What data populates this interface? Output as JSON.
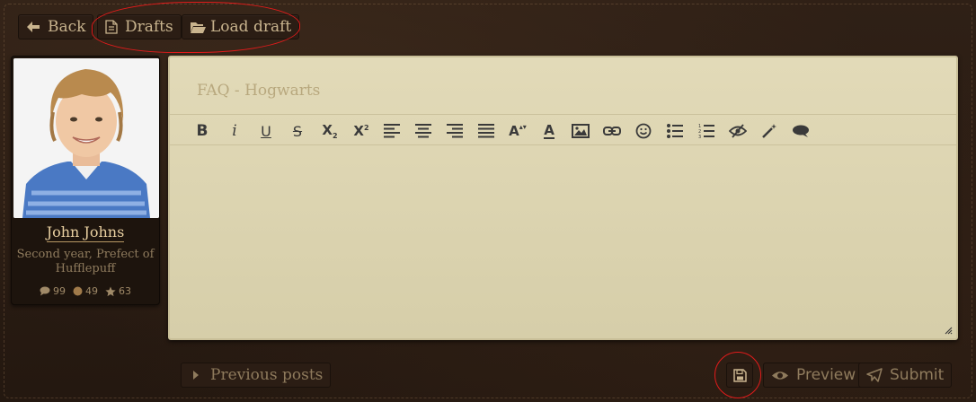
{
  "nav": {
    "back_label": "Back",
    "drafts_label": "Drafts",
    "load_draft_label": "Load draft"
  },
  "profile": {
    "name": "John Johns",
    "title": "Second year, Prefect of Hufflepuff",
    "posts": "99",
    "likes": "49",
    "stars": "63"
  },
  "editor": {
    "subject_placeholder": "FAQ - Hogwarts",
    "body_value": ""
  },
  "toolbar": {
    "bold": "B",
    "italic": "i",
    "underline": "U",
    "strike": "S",
    "subscript": "X",
    "subscript_mark": "2",
    "superscript": "X",
    "superscript_mark": "2",
    "font_size": "A",
    "font_color": "A"
  },
  "footer": {
    "previous_posts_label": "Previous posts",
    "preview_label": "Preview",
    "submit_label": "Submit"
  },
  "colors": {
    "annotation": "#e21b1b",
    "editor_bg": "#ddd5b2",
    "leather": "#2a1c12"
  }
}
